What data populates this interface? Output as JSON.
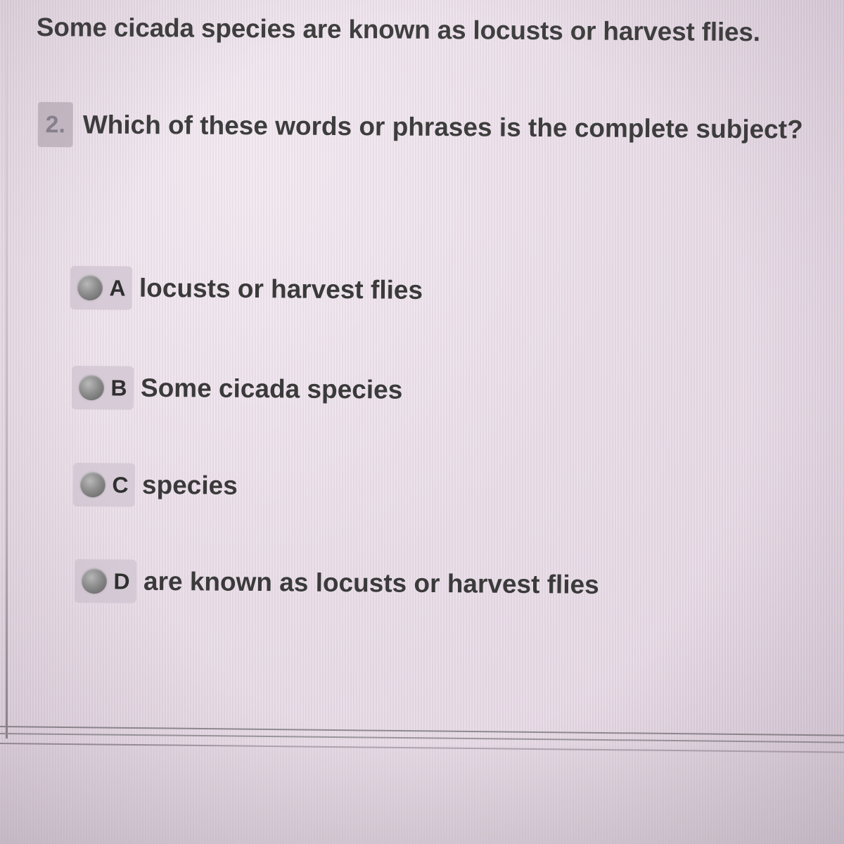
{
  "passage": {
    "text": "Some cicada species are known as locusts or harvest flies."
  },
  "question": {
    "number": "2.",
    "text": "Which of these words or phrases is the complete subject?"
  },
  "options": [
    {
      "letter": "A",
      "text": "locusts or harvest flies"
    },
    {
      "letter": "B",
      "text": "Some cicada species"
    },
    {
      "letter": "C",
      "text": "species"
    },
    {
      "letter": "D",
      "text": "are known as locusts or harvest flies"
    }
  ],
  "colors": {
    "background": "#e9dde8",
    "option_button": "#d6cbd6",
    "question_badge": "#c7bcc6",
    "text": "#3d3d3d"
  }
}
